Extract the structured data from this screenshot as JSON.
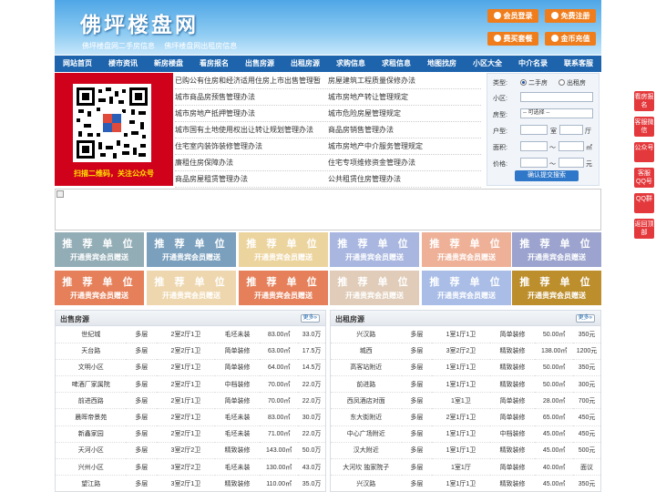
{
  "header": {
    "logo": "佛坪楼盘网",
    "sub_links": [
      "佛坪楼盘网二手房信息",
      "佛坪楼盘网出租房信息"
    ],
    "buttons": [
      "会员登录",
      "免费注册",
      "费买套餐",
      "金币充值"
    ]
  },
  "nav": [
    "网站首页",
    "楼市资讯",
    "新房楼盘",
    "看房报名",
    "出售房源",
    "出租房源",
    "求购信息",
    "求租信息",
    "地图找房",
    "小区大全",
    "中介名录",
    "联系客服"
  ],
  "qr": {
    "caption": "扫描二维码，关注公众号"
  },
  "links": [
    [
      "已购公有住房和经济适用住房上市出售管理暂",
      "房屋建筑工程质量保修办法"
    ],
    [
      "城市商品房预售管理办法",
      "城市房地产转让管理规定"
    ],
    [
      "城市房地产抵押管理办法",
      "城市危险房屋管理规定"
    ],
    [
      "城市国有土地使用权出让转让规划管理办法",
      "商品房销售管理办法"
    ],
    [
      "住宅室内装饰装修管理办法",
      "城市房地产中介服务管理规定"
    ],
    [
      "廉租住房保障办法",
      "住宅专项维修资金管理办法"
    ],
    [
      "商品房屋租赁管理办法",
      "公共租赁住房管理办法"
    ]
  ],
  "search": {
    "type_label": "类型:",
    "opt_sale": "二手房",
    "opt_rent": "出租房",
    "community_label": "小区:",
    "style_label": "房型:",
    "style_value": "-- 可选择 --",
    "layout_label": "户型:",
    "room_unit": "室",
    "hall_unit": "厅",
    "area_label": "面积:",
    "area_unit": "㎡",
    "range_sep": "～",
    "price_label": "价格:",
    "price_unit": "元",
    "submit": "确认提交搜索"
  },
  "tiles": {
    "line1": "推 荐 单 位",
    "line2": "开通贵宾会员赠送"
  },
  "sale_panel": {
    "title": "出售房源",
    "more": "更多»",
    "rows": [
      [
        "世纪城",
        "多层",
        "2室2厅1卫",
        "毛坯未装",
        "83.00㎡",
        "33.0万"
      ],
      [
        "天台路",
        "多层",
        "2室2厅1卫",
        "简单装修",
        "63.00㎡",
        "17.5万"
      ],
      [
        "文明小区",
        "多层",
        "2室1厅1卫",
        "简单装修",
        "64.00㎡",
        "14.5万"
      ],
      [
        "啤酒厂家属院",
        "多层",
        "2室2厅1卫",
        "中档装修",
        "70.00㎡",
        "22.0万"
      ],
      [
        "前进西路",
        "多层",
        "2室1厅1卫",
        "简单装修",
        "70.00㎡",
        "22.0万"
      ],
      [
        "晨晖帝景苑",
        "多层",
        "2室2厅1卫",
        "毛坯未装",
        "83.00㎡",
        "30.0万"
      ],
      [
        "新鑫家园",
        "多层",
        "2室2厅1卫",
        "毛坯未装",
        "71.00㎡",
        "22.0万"
      ],
      [
        "天河小区",
        "多层",
        "3室2厅2卫",
        "精致装修",
        "143.00㎡",
        "50.0万"
      ],
      [
        "兴州小区",
        "多层",
        "3室2厅2卫",
        "毛坯未装",
        "130.00㎡",
        "43.0万"
      ],
      [
        "望江路",
        "多层",
        "3室2厅1卫",
        "精致装修",
        "110.00㎡",
        "35.0万"
      ]
    ]
  },
  "rent_panel": {
    "title": "出租房源",
    "more": "更多»",
    "rows": [
      [
        "兴汉路",
        "多层",
        "1室1厅1卫",
        "简单装修",
        "50.00㎡",
        "350元"
      ],
      [
        "城西",
        "多层",
        "3室2厅2卫",
        "精致装修",
        "138.00㎡",
        "1200元"
      ],
      [
        "高客站附近",
        "多层",
        "1室1厅1卫",
        "精致装修",
        "50.00㎡",
        "350元"
      ],
      [
        "前进路",
        "多层",
        "1室1厅1卫",
        "精致装修",
        "50.00㎡",
        "300元"
      ],
      [
        "西凤酒店对面",
        "多层",
        "1室1卫",
        "简单装修",
        "28.00㎡",
        "700元"
      ],
      [
        "东大街附近",
        "多层",
        "2室1厅1卫",
        "简单装修",
        "65.00㎡",
        "450元"
      ],
      [
        "中心广场附近",
        "多层",
        "1室1厅1卫",
        "中档装修",
        "45.00㎡",
        "450元"
      ],
      [
        "汉大附近",
        "多层",
        "1室1厅1卫",
        "精致装修",
        "45.00㎡",
        "500元"
      ],
      [
        "大河坎 独家院子",
        "多层",
        "1室1厅",
        "简单装修",
        "40.00㎡",
        "面议"
      ],
      [
        "兴汉路",
        "多层",
        "1室1厅1卫",
        "精致装修",
        "45.00㎡",
        "350元"
      ]
    ]
  },
  "float_bar": [
    "看房报名",
    "客服微信",
    "公众号",
    "客服QQ号",
    "QQ群",
    "返回顶部"
  ]
}
